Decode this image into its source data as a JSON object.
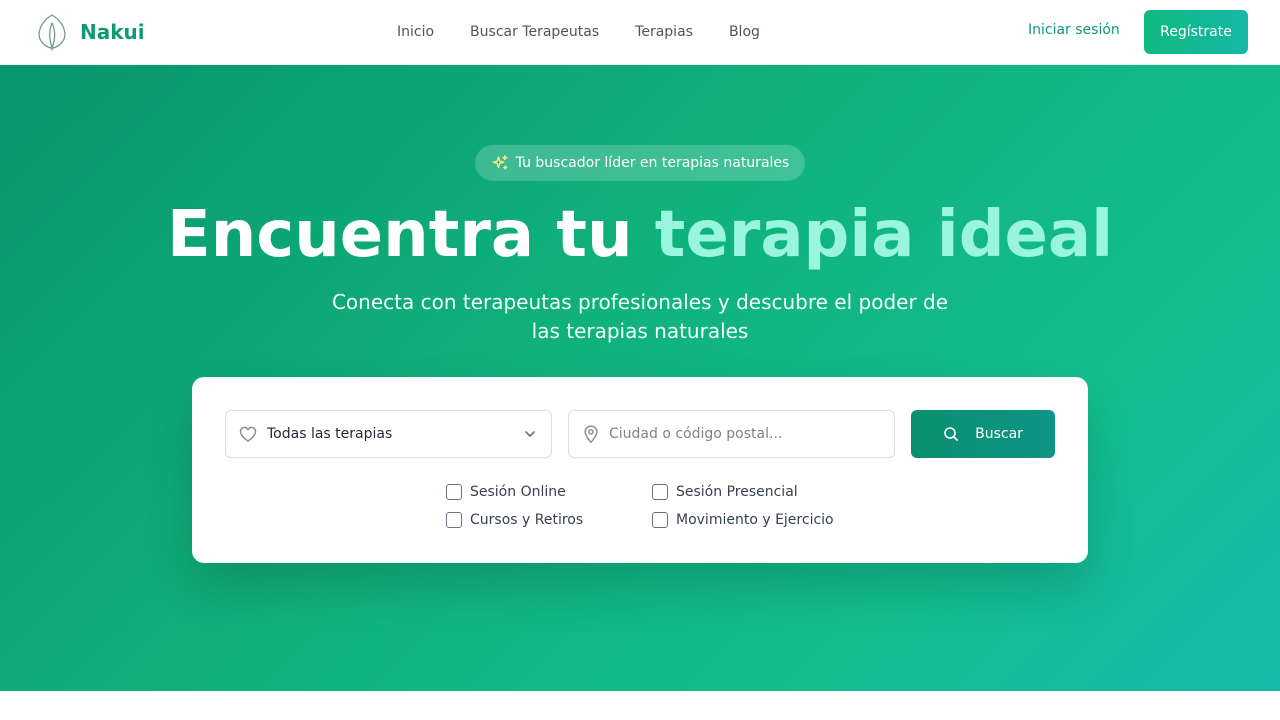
{
  "brand": {
    "name": "Nakui",
    "logo_icon": "leaf-icon",
    "color": "#0f9a73"
  },
  "nav": {
    "links": [
      "Inicio",
      "Buscar Terapeutas",
      "Terapias",
      "Blog"
    ],
    "login_label": "Iniciar sesión",
    "register_label": "Regístrate"
  },
  "hero": {
    "badge_icon": "sparkles-icon",
    "badge_text": "Tu buscador líder en terapias naturales",
    "title_part1": "Encuentra tu",
    "title_highlight": "terapia ideal",
    "subtitle": "Conecta con terapeutas profesionales y descubre el poder de las terapias naturales",
    "gradient_start": "#08966c",
    "gradient_end": "#15b9a8",
    "highlight_color": "#9af5de"
  },
  "search": {
    "therapy_icon": "heart-icon",
    "therapy_selected": "Todas las terapias",
    "location_icon": "map-pin-icon",
    "location_value": "",
    "location_placeholder": "Ciudad o código postal...",
    "button_label": "Buscar",
    "button_icon": "search-icon",
    "filters": [
      {
        "label": "Sesión Online",
        "checked": false
      },
      {
        "label": "Sesión Presencial",
        "checked": false
      },
      {
        "label": "Cursos y Retiros",
        "checked": false
      },
      {
        "label": "Movimiento y Ejercicio",
        "checked": false
      }
    ]
  }
}
